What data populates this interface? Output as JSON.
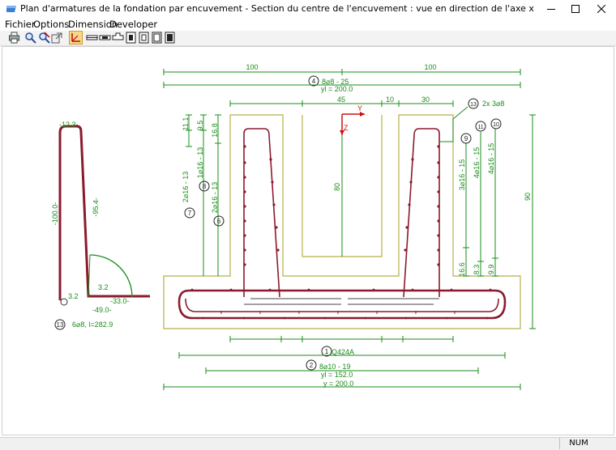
{
  "window": {
    "title": "Plan d'armatures de la fondation par encuvement  - Section du centre de l'encuvement : vue en direction de l'axe x"
  },
  "menu": [
    "Fichier",
    "Options",
    "Dimension",
    "Developer"
  ],
  "toolbar": {
    "icons": [
      "print-icon",
      "zoom-icon",
      "zoom-reset-icon",
      "export-icon",
      "axes-icon",
      "view-1-icon",
      "view-2-icon",
      "view-3-icon",
      "view-4-icon",
      "view-5-icon",
      "view-6-icon",
      "view-7-icon"
    ],
    "active_icon": "axes-icon"
  },
  "colors": {
    "dim": "#1a8c1a",
    "rebar": "#8b1a2e",
    "concrete": "#b5b04a",
    "axis": "#cc1111"
  },
  "drawing": {
    "dim_top_left": "100",
    "dim_top_right": "100",
    "mark4_num": "4",
    "mark4_text": "8⌀8 - 25",
    "yl_top": "yl = 200.0",
    "dim_45": "45",
    "dim_10": "10",
    "dim_30": "30",
    "mark13_num": "13",
    "mark13_text": "2x 3⌀8",
    "dim_11_1": "11.1",
    "dim_9_5": "9.5",
    "dim_16_8": "16.8",
    "mark7_text": "2⌀16 - 13",
    "mark8_text": "1⌀16 - 13",
    "mark6_text": "2⌀16 - 13",
    "mark7_num": "7",
    "mark8_num": "8",
    "mark6_num": "6",
    "mark9_num": "9",
    "mark11_num": "11",
    "mark10_num": "10",
    "mark9_text": "3⌀16 - 15",
    "mark11_text": "4⌀16 - 15",
    "mark10_text": "4⌀16 - 15",
    "dim_16_6": "16.6",
    "dim_8_3": "8.3",
    "dim_9_9": "9.9",
    "dim_80": "80",
    "dim_90": "90",
    "axis_y": "Y",
    "axis_z": "Z",
    "mark1_num": "1",
    "mark1_text": "Q424A",
    "mark2_num": "2",
    "mark2_text": "8⌀10 - 19",
    "yl_bottom": "yl = 152.0",
    "y_bottom": "y = 200.0",
    "detail_top": "-12.3-",
    "detail_left": "-100.0-",
    "detail_slope": "-95.4-",
    "detail_r1": "3.2",
    "detail_r2": "3.2",
    "detail_foot": "-33.0-",
    "detail_bottom": "-49.0-",
    "detail_mark_num": "13",
    "detail_mark_text": "6⌀8, l=282.9"
  },
  "status": {
    "num": "NUM"
  }
}
